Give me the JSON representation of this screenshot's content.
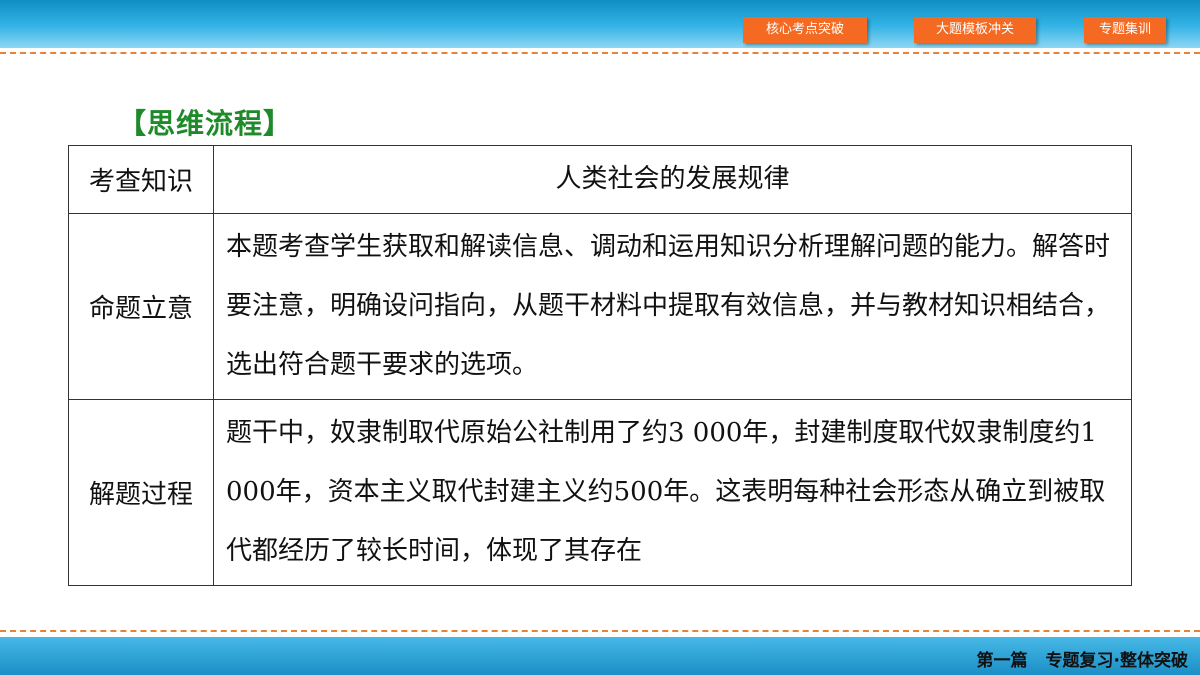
{
  "header": {
    "nav": [
      {
        "label": "核心考点突破"
      },
      {
        "label": "大题模板冲关"
      },
      {
        "label": "专题集训"
      }
    ]
  },
  "section": {
    "title": "【思维流程】"
  },
  "table": {
    "rows": [
      {
        "label": "考查知识",
        "content": "人类社会的发展规律"
      },
      {
        "label": "命题立意",
        "content": "本题考查学生获取和解读信息、调动和运用知识分析理解问题的能力。解答时要注意，明确设问指向，从题干材料中提取有效信息，并与教材知识相结合，选出符合题干要求的选项。"
      },
      {
        "label": "解题过程",
        "content": "题干中，奴隶制取代原始公社制用了约3 000年，封建制度取代奴隶制度约1 000年，资本主义取代封建主义约500年。这表明每种社会形态从确立到被取代都经历了较长时间，体现了其存在"
      }
    ]
  },
  "footer": {
    "part": "第一篇",
    "title": "专题复习·整体突破"
  }
}
